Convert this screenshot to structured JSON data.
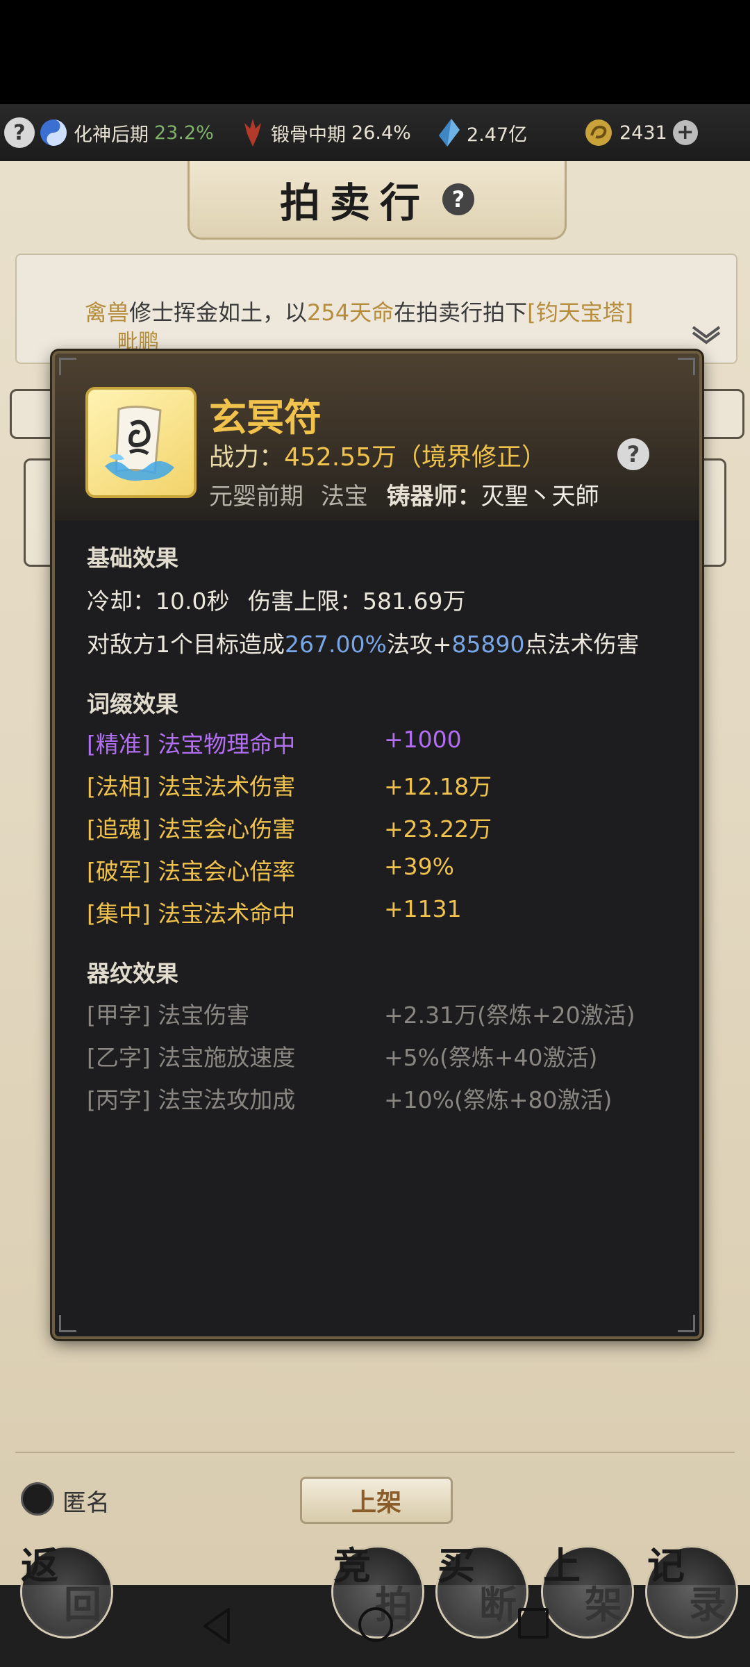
{
  "status_bar": {
    "help_glyph": "?",
    "realm_label": "化神后期",
    "realm_pct": "23.2%",
    "body_label": "锻骨中期",
    "body_pct": "26.4%",
    "spirit_stones": "2.47亿",
    "currency": "2431",
    "plus_glyph": "+"
  },
  "page": {
    "title": "拍卖行",
    "help_glyph": "?"
  },
  "news": {
    "prefix": "禽兽",
    "middle1": "修士挥金如土，以",
    "amount": "254天命",
    "middle2": "在拍卖行拍下",
    "item": "[钧天宝塔]",
    "line2": "毗鹏"
  },
  "item": {
    "name": "玄冥符",
    "power_label": "战力：",
    "power_value": "452.55万（境界修正）",
    "help_glyph": "?",
    "realm": "元婴前期",
    "category": "法宝",
    "forger_label": "铸器师：",
    "forger": "灭聖丶天師",
    "colors": {
      "name": "#f1c24c",
      "accent_blue": "#78a6e6",
      "purple": "#b36ff3",
      "grey": "#8a8782"
    }
  },
  "base_effects": {
    "title": "基础效果",
    "cooldown_label": "冷却：",
    "cooldown": "10.0秒",
    "cap_label": "伤害上限：",
    "cap": "581.69万",
    "desc_prefix": "对敌方1个目标造成",
    "desc_pct": "267.00%",
    "desc_mid": "法攻+",
    "desc_flat": "85890",
    "desc_suffix": "点法术伤害"
  },
  "affix_effects": {
    "title": "词缀效果",
    "rows": [
      {
        "name": "[精准] 法宝物理命中",
        "value": "+1000",
        "color": "purple"
      },
      {
        "name": "[法相] 法宝法术伤害",
        "value": "+12.18万",
        "color": "gold"
      },
      {
        "name": "[追魂] 法宝会心伤害",
        "value": "+23.22万",
        "color": "gold"
      },
      {
        "name": "[破军] 法宝会心倍率",
        "value": "+39%",
        "color": "gold"
      },
      {
        "name": "[集中] 法宝法术命中",
        "value": "+1131",
        "color": "gold"
      }
    ]
  },
  "pattern_effects": {
    "title": "器纹效果",
    "rows": [
      {
        "name": "[甲字] 法宝伤害",
        "value": "+2.31万(祭炼+20激活)"
      },
      {
        "name": "[乙字] 法宝施放速度",
        "value": "+5%(祭炼+40激活)"
      },
      {
        "name": "[丙字] 法宝法攻加成",
        "value": "+10%(祭炼+80激活)"
      }
    ]
  },
  "bottom": {
    "anonymous_label": "匿名",
    "list_button": "上架",
    "back_button": {
      "top": "返",
      "bottom": "回"
    },
    "bid_button": {
      "top": "竞",
      "bottom": "拍"
    },
    "buyout_button": {
      "top": "买",
      "bottom": "断"
    },
    "shelf_button": {
      "top": "上",
      "bottom": "架"
    },
    "record_button": {
      "top": "记",
      "bottom": "录"
    }
  }
}
